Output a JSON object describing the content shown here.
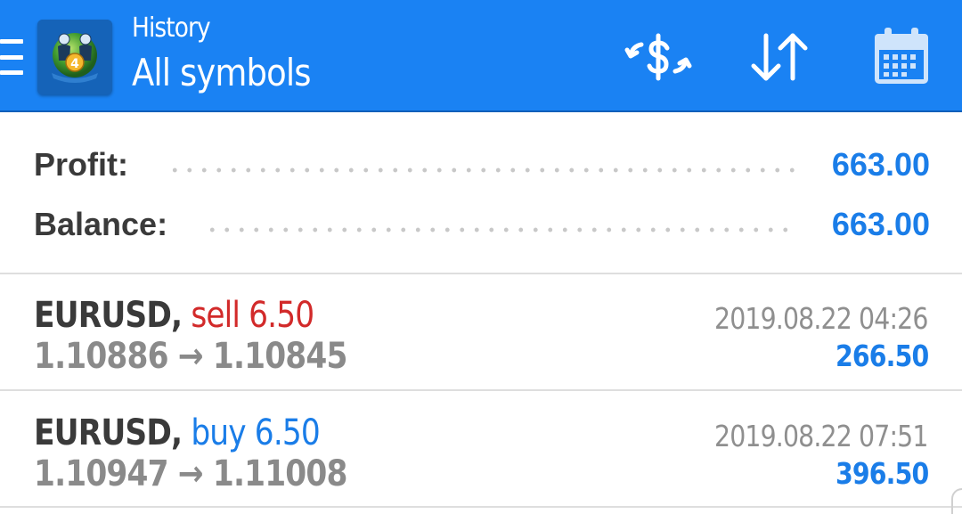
{
  "header": {
    "title": "History",
    "subtitle": "All symbols",
    "icons": {
      "menu": "menu-icon",
      "logo": "metatrader4-logo",
      "trade": "dollar-exchange-icon",
      "sort": "sort-icon",
      "calendar": "calendar-icon"
    },
    "colors": {
      "bar": "#1a82f3"
    }
  },
  "summary": {
    "profit_label": "Profit:",
    "profit_value": "663.00",
    "balance_label": "Balance:",
    "balance_value": "663.00"
  },
  "deals": [
    {
      "symbol": "EURUSD,",
      "action": "sell 6.50",
      "open_price": "1.10886",
      "arrow": "→",
      "close_price": "1.10845",
      "time": "2019.08.22 04:26",
      "profit": "266.50"
    },
    {
      "symbol": "EURUSD,",
      "action": "buy 6.50",
      "open_price": "1.10947",
      "arrow": "→",
      "close_price": "1.11008",
      "time": "2019.08.22 07:51",
      "profit": "396.50"
    }
  ],
  "colors": {
    "accent": "#1a7de8",
    "sell": "#d22a2a",
    "text": "#3a3a3a",
    "muted": "#8a8a8a"
  }
}
